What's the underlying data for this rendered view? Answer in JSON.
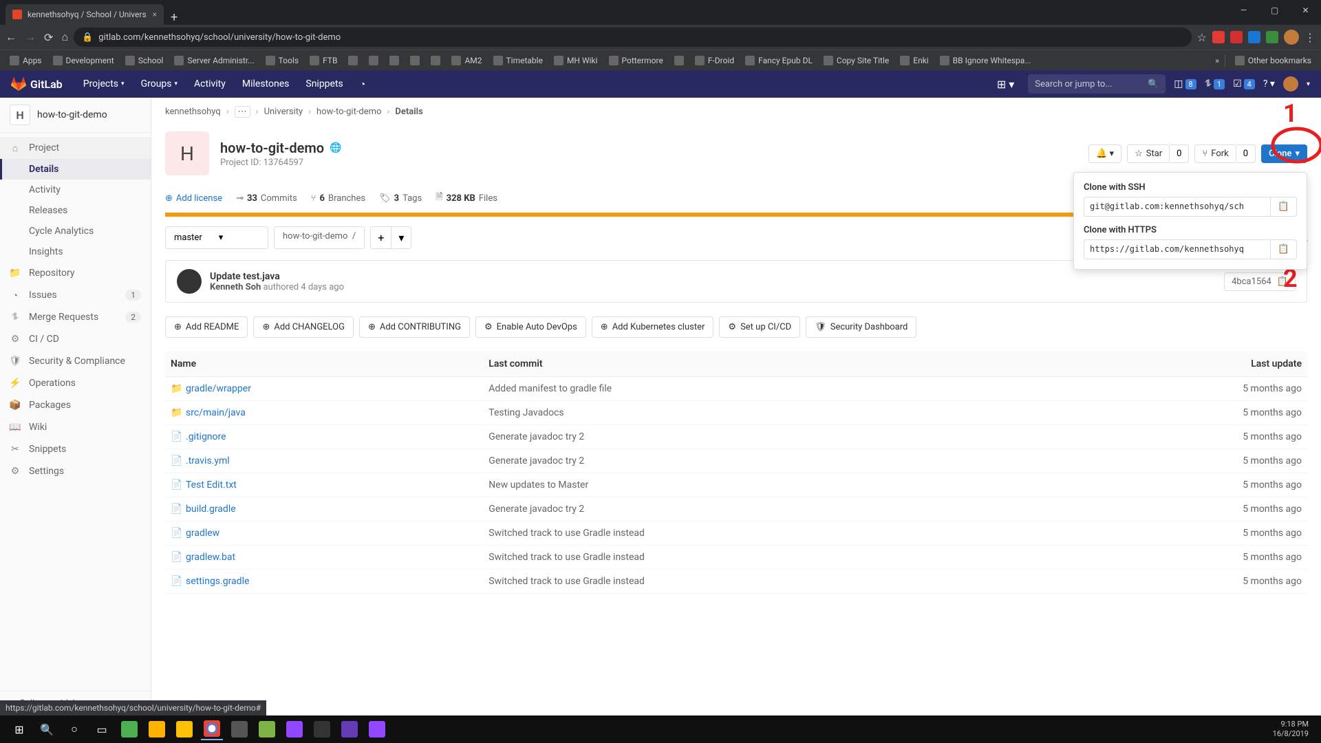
{
  "browser": {
    "tab_title": "kennethsohyq / School / Univers",
    "url": "gitlab.com/kennethsohyq/school/university/how-to-git-demo",
    "bookmarks": [
      "Apps",
      "Development",
      "School",
      "Server Administr...",
      "Tools",
      "FTB",
      "",
      "",
      "",
      "",
      "",
      "AM2",
      "Timetable",
      "MH Wiki",
      "Pottermore",
      "",
      "F-Droid",
      "Fancy Epub DL",
      "Copy Site Title",
      "Enki",
      "BB Ignore Whitespa..."
    ],
    "other_bookmarks": "Other bookmarks",
    "status_url": "https://gitlab.com/kennethsohyq/school/university/how-to-git-demo#"
  },
  "gitlab_header": {
    "brand": "GitLab",
    "nav": [
      "Projects",
      "Groups",
      "Activity",
      "Milestones",
      "Snippets"
    ],
    "search_placeholder": "Search or jump to...",
    "issues_badge": "8",
    "mr_badge": "1",
    "todo_badge": "4"
  },
  "sidebar": {
    "avatar_letter": "H",
    "project_name": "how-to-git-demo",
    "items": [
      {
        "label": "Project",
        "sub": [
          "Details",
          "Activity",
          "Releases",
          "Cycle Analytics",
          "Insights"
        ]
      },
      {
        "label": "Repository"
      },
      {
        "label": "Issues",
        "badge": "1"
      },
      {
        "label": "Merge Requests",
        "badge": "2"
      },
      {
        "label": "CI / CD"
      },
      {
        "label": "Security & Compliance"
      },
      {
        "label": "Operations"
      },
      {
        "label": "Packages"
      },
      {
        "label": "Wiki"
      },
      {
        "label": "Snippets"
      },
      {
        "label": "Settings"
      }
    ],
    "collapse": "Collapse sidebar"
  },
  "breadcrumbs": [
    "kennethsohyq",
    "...",
    "University",
    "how-to-git-demo",
    "Details"
  ],
  "project": {
    "avatar_letter": "H",
    "name": "how-to-git-demo",
    "id_label": "Project ID: 13764597",
    "star": "Star",
    "star_count": "0",
    "fork": "Fork",
    "fork_count": "0",
    "clone": "Clone"
  },
  "stats": {
    "license": "Add license",
    "commits_n": "33",
    "commits_l": "Commits",
    "branches_n": "6",
    "branches_l": "Branches",
    "tags_n": "3",
    "tags_l": "Tags",
    "size_n": "328 KB",
    "size_l": "Files"
  },
  "branch": {
    "selected": "master",
    "path": "how-to-git-demo"
  },
  "commit": {
    "title": "Update test.java",
    "author": "Kenneth Soh",
    "verb": "authored",
    "when": "4 days ago",
    "sha": "4bca1564"
  },
  "actions": [
    "Add README",
    "Add CHANGELOG",
    "Add CONTRIBUTING",
    "Enable Auto DevOps",
    "Add Kubernetes cluster",
    "Set up CI/CD",
    "Security Dashboard"
  ],
  "table": {
    "headers": [
      "Name",
      "Last commit",
      "Last update"
    ],
    "rows": [
      {
        "type": "folder",
        "name": "gradle/wrapper",
        "commit": "Added manifest to gradle file",
        "when": "5 months ago"
      },
      {
        "type": "folder",
        "name": "src/main/java",
        "commit": "Testing Javadocs",
        "when": "5 months ago"
      },
      {
        "type": "file",
        "name": ".gitignore",
        "commit": "Generate javadoc try 2",
        "when": "5 months ago"
      },
      {
        "type": "file",
        "name": ".travis.yml",
        "commit": "Generate javadoc try 2",
        "when": "5 months ago"
      },
      {
        "type": "file",
        "name": "Test Edit.txt",
        "commit": "New updates to Master",
        "when": "5 months ago"
      },
      {
        "type": "file",
        "name": "build.gradle",
        "commit": "Generate javadoc try 2",
        "when": "5 months ago"
      },
      {
        "type": "file",
        "name": "gradlew",
        "commit": "Switched track to use Gradle instead",
        "when": "5 months ago"
      },
      {
        "type": "file",
        "name": "gradlew.bat",
        "commit": "Switched track to use Gradle instead",
        "when": "5 months ago"
      },
      {
        "type": "file",
        "name": "settings.gradle",
        "commit": "Switched track to use Gradle instead",
        "when": "5 months ago"
      }
    ]
  },
  "clone_popover": {
    "ssh_label": "Clone with SSH",
    "ssh_url": "git@gitlab.com:kennethsohyq/sch",
    "https_label": "Clone with HTTPS",
    "https_url": "https://gitlab.com/kennethsohyq"
  },
  "annotations": {
    "one": "1",
    "two": "2"
  },
  "taskbar": {
    "time": "9:18 PM",
    "date": "16/8/2019"
  }
}
